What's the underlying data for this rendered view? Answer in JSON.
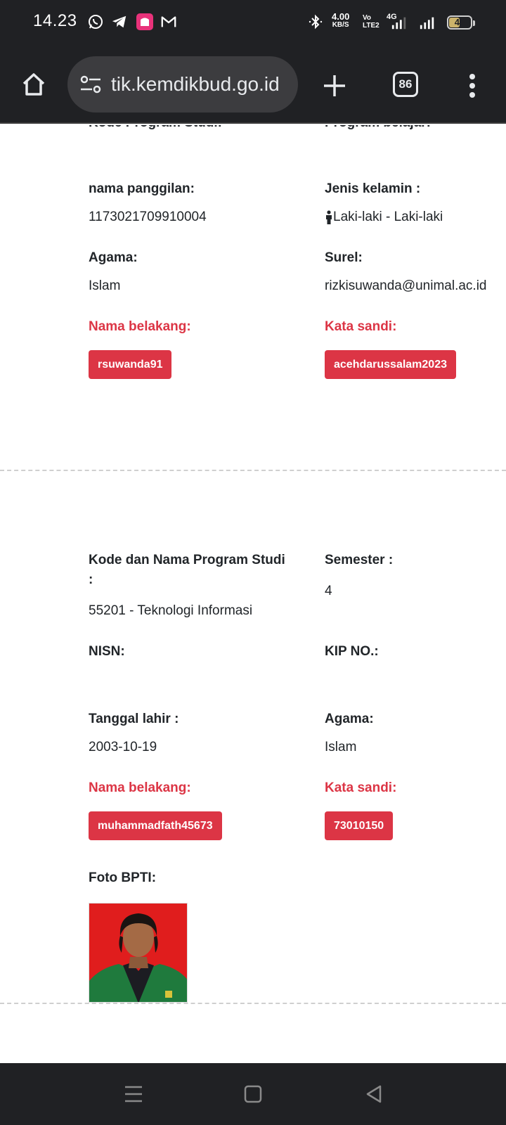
{
  "status_bar": {
    "time": "14.23",
    "net_speed_value": "4.00",
    "net_speed_unit": "KB/S",
    "volte_line1": "Vo",
    "volte_line2": "LTE2",
    "network": "4G",
    "battery": "48",
    "battery_level": 0.48,
    "notification_icons": [
      "whatsapp-icon",
      "telegram-icon",
      "lazada-icon",
      "gmail-icon"
    ]
  },
  "browser": {
    "url": "tik.kemdikbud.go.id",
    "tab_count": "86"
  },
  "record1": {
    "partial_left_label": "Kode Program Studi:",
    "partial_right_label": "Program belajar:",
    "nickname_label": "nama panggilan:",
    "nickname_value": "1173021709910004",
    "gender_label": "Jenis kelamin :",
    "gender_value": "Laki-laki - Laki-laki",
    "religion_label": "Agama:",
    "religion_value": "Islam",
    "email_label": "Surel:",
    "email_value": "rizkisuwanda@unimal.ac.id",
    "lastname_label": "Nama belakang:",
    "lastname_value": "rsuwanda91",
    "password_label": "Kata sandi:",
    "password_value": "acehdarussalam2023"
  },
  "record2": {
    "program_label_line1": "Kode dan Nama Program Studi",
    "program_label_line2": ":",
    "program_value": "55201 - Teknologi Informasi",
    "semester_label": "Semester :",
    "semester_value": "4",
    "nisn_label": "NISN:",
    "kip_label": "KIP NO.:",
    "birthdate_label": "Tanggal lahir :",
    "birthdate_value": "2003-10-19",
    "religion_label": "Agama:",
    "religion_value": "Islam",
    "lastname_label": "Nama belakang:",
    "lastname_value": "muhammadfath45673",
    "password_label": "Kata sandi:",
    "password_value": "73010150",
    "photo_label": "Foto BPTI:"
  },
  "colors": {
    "accent_red": "#dc3545",
    "chrome_dark": "#202124"
  }
}
